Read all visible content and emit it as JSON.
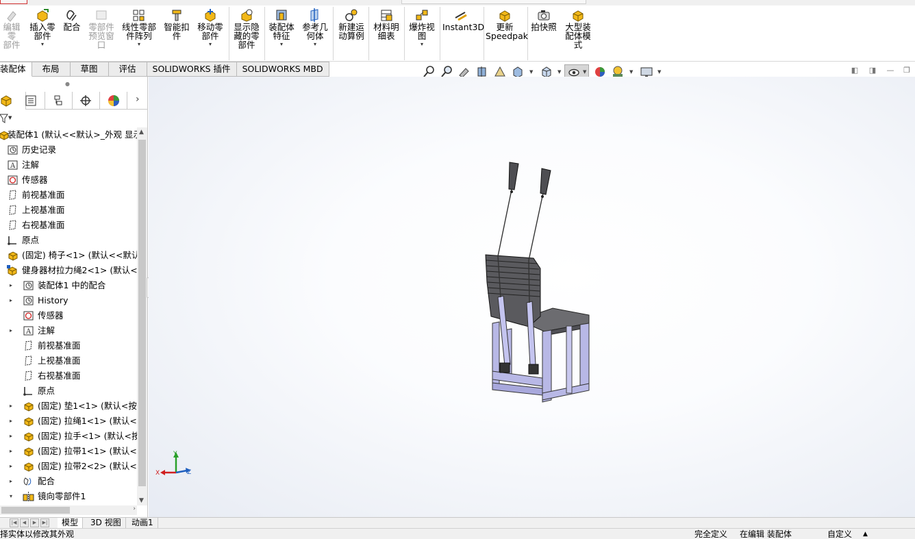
{
  "ribbon": {
    "buttons": [
      {
        "label": "编辑零\n部件",
        "icon": "edit-component-icon",
        "disabled": true
      },
      {
        "label": "插入零\n部件",
        "icon": "insert-components-icon",
        "caret": true
      },
      {
        "label": "配合",
        "icon": "mate-icon"
      },
      {
        "label": "零部件\n预览窗\n口",
        "icon": "component-preview-icon",
        "disabled": true
      },
      {
        "label": "线性零部\n件阵列",
        "icon": "linear-pattern-icon",
        "caret": true
      },
      {
        "label": "智能扣\n件",
        "icon": "smart-fasteners-icon"
      },
      {
        "label": "移动零\n部件",
        "icon": "move-component-icon",
        "caret": true
      },
      {
        "label": "显示隐\n藏的零\n部件",
        "icon": "show-hidden-icon"
      },
      {
        "label": "装配体\n特征",
        "icon": "assembly-features-icon",
        "caret": true
      },
      {
        "label": "参考几\n何体",
        "icon": "reference-geometry-icon",
        "caret": true
      },
      {
        "label": "新建运\n动算例",
        "icon": "motion-study-icon"
      },
      {
        "label": "材料明\n细表",
        "icon": "bom-icon"
      },
      {
        "label": "爆炸视\n图",
        "icon": "exploded-view-icon",
        "caret": true
      },
      {
        "label": "Instant3D",
        "icon": "instant3d-icon"
      },
      {
        "label": "更新\nSpeedpak",
        "icon": "speedpak-icon"
      },
      {
        "label": "拍快照",
        "icon": "snapshot-icon"
      },
      {
        "label": "大型装\n配体模\n式",
        "icon": "large-assembly-icon"
      }
    ]
  },
  "tabs": [
    "装配体",
    "布局",
    "草图",
    "评估",
    "SOLIDWORKS 插件",
    "SOLIDWORKS MBD"
  ],
  "tree": [
    {
      "label": "装配体1 (默认<<默认>_外观 显示",
      "icon": "assembly",
      "indent": 0,
      "expander": ""
    },
    {
      "label": "历史记录",
      "icon": "history",
      "indent": 1,
      "expander": ""
    },
    {
      "label": "注解",
      "icon": "annotation",
      "indent": 1,
      "expander": ""
    },
    {
      "label": "传感器",
      "icon": "sensor",
      "indent": 1,
      "expander": ""
    },
    {
      "label": "前视基准面",
      "icon": "plane",
      "indent": 1,
      "expander": ""
    },
    {
      "label": "上视基准面",
      "icon": "plane",
      "indent": 1,
      "expander": ""
    },
    {
      "label": "右视基准面",
      "icon": "plane",
      "indent": 1,
      "expander": ""
    },
    {
      "label": "原点",
      "icon": "origin",
      "indent": 1,
      "expander": ""
    },
    {
      "label": "(固定) 椅子<1> (默认<<默认>",
      "icon": "part",
      "indent": 1,
      "expander": ""
    },
    {
      "label": "健身器材拉力绳2<1> (默认<<默",
      "icon": "subassembly",
      "indent": 1,
      "expander": "▾"
    },
    {
      "label": "装配体1 中的配合",
      "icon": "history",
      "indent": 2,
      "expander": "▸"
    },
    {
      "label": "History",
      "icon": "history",
      "indent": 2,
      "expander": "▸"
    },
    {
      "label": "传感器",
      "icon": "sensor",
      "indent": 2,
      "expander": ""
    },
    {
      "label": "注解",
      "icon": "annotation",
      "indent": 2,
      "expander": "▸"
    },
    {
      "label": "前视基准面",
      "icon": "plane",
      "indent": 2,
      "expander": ""
    },
    {
      "label": "上视基准面",
      "icon": "plane",
      "indent": 2,
      "expander": ""
    },
    {
      "label": "右视基准面",
      "icon": "plane",
      "indent": 2,
      "expander": ""
    },
    {
      "label": "原点",
      "icon": "origin",
      "indent": 2,
      "expander": ""
    },
    {
      "label": "(固定) 垫1<1> (默认<按加",
      "icon": "part",
      "indent": 2,
      "expander": "▸"
    },
    {
      "label": "(固定) 拉绳1<1> (默认<按",
      "icon": "part",
      "indent": 2,
      "expander": "▸"
    },
    {
      "label": "(固定) 拉手<1> (默认<按加",
      "icon": "part",
      "indent": 2,
      "expander": "▸"
    },
    {
      "label": "(固定) 拉带1<1> (默认<按",
      "icon": "part",
      "indent": 2,
      "expander": "▸"
    },
    {
      "label": "(固定) 拉带2<2> (默认<按",
      "icon": "part",
      "indent": 2,
      "expander": "▸"
    },
    {
      "label": "配合",
      "icon": "mates",
      "indent": 2,
      "expander": "▸"
    },
    {
      "label": "镜向零部件1",
      "icon": "mirror",
      "indent": 2,
      "expander": "▾"
    }
  ],
  "bottom_tabs": [
    "模型",
    "3D 视图",
    "动画1"
  ],
  "status": {
    "hint": "择实体以修改其外观",
    "definition": "完全定义",
    "editing": "在编辑 装配体",
    "units": "自定义",
    "units_caret": "▲"
  },
  "triad": {
    "x": "X",
    "y": "Y",
    "z": "Z"
  },
  "colors": {
    "accent_blue": "#1f5fbf",
    "part_yellow": "#f2b818",
    "rod_lavender": "#b8b8e6"
  }
}
